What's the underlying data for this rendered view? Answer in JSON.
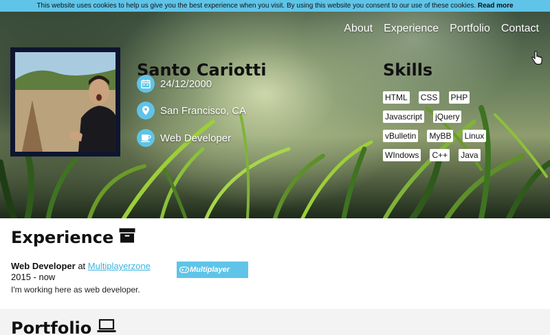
{
  "cookie_bar": {
    "text": "This website uses cookies to help us give you the best experience when you visit. By using this website you consent to our use of these cookies.",
    "link_label": "Read more"
  },
  "nav": {
    "items": [
      "About",
      "Experience",
      "Portfolio",
      "Contact"
    ]
  },
  "profile": {
    "name": "Santo Cariotti",
    "birthdate": "24/12/2000",
    "location": "San Francisco, CA",
    "role": "Web Developer",
    "icons": [
      "calendar-icon",
      "location-pin-icon",
      "coffee-cup-icon"
    ]
  },
  "skills": {
    "title": "Skills",
    "items": [
      "HTML",
      "CSS",
      "PHP",
      "Javascript",
      "jQuery",
      "vBulletin",
      "MyBB",
      "Linux",
      "WIndows",
      "C++",
      "Java"
    ]
  },
  "experience": {
    "title": "Experience",
    "icon": "archive-box-icon",
    "jobs": [
      {
        "title": "Web Developer",
        "connector": "at",
        "company": "Multiplayerzone",
        "years": "2015 - now",
        "description": "I'm working here as web developer.",
        "logo_text": "Multiplayer"
      }
    ]
  },
  "portfolio": {
    "title": "Portfolio",
    "icon": "laptop-icon"
  },
  "colors": {
    "accent": "#5fc4e8",
    "avatar_frame": "#0e1530",
    "link": "#3ab4e0"
  }
}
